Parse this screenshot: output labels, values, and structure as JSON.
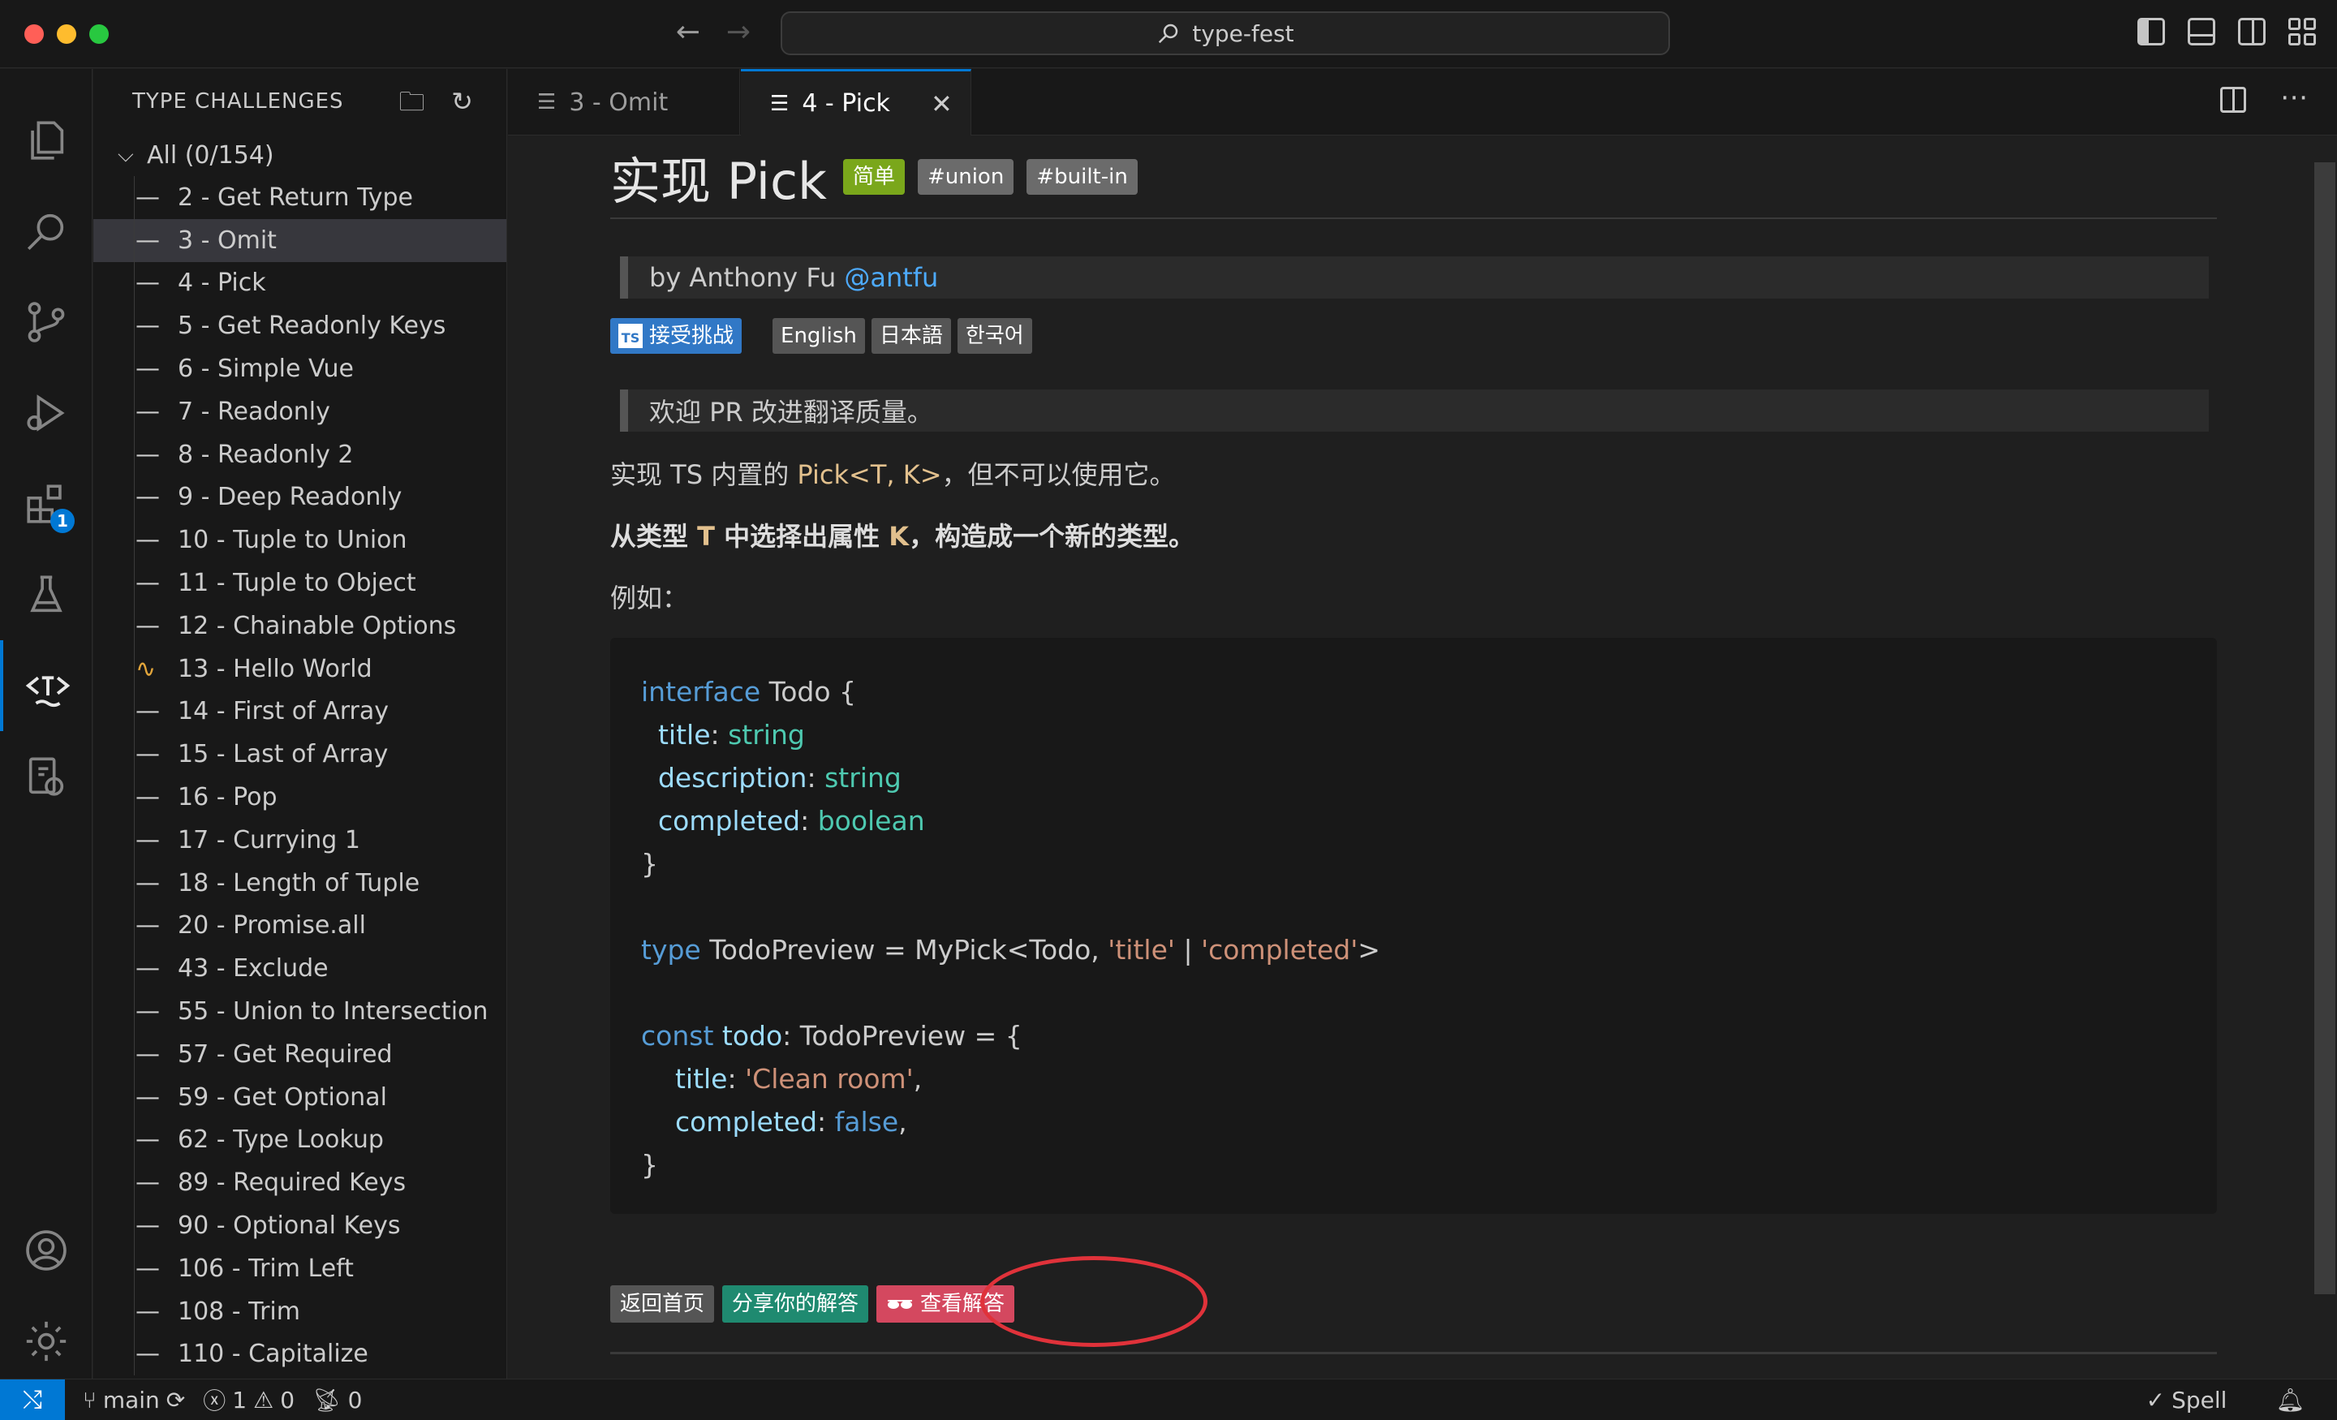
{
  "window": {
    "search_text": "type-fest"
  },
  "sidebar": {
    "header": "TYPE CHALLENGES",
    "root_label": "All (0/154)",
    "items": [
      {
        "label": "2 - Get Return Type",
        "mark": "—"
      },
      {
        "label": "3 - Omit",
        "mark": "—",
        "selected": true
      },
      {
        "label": "4 - Pick",
        "mark": "—"
      },
      {
        "label": "5 - Get Readonly Keys",
        "mark": "—"
      },
      {
        "label": "6 - Simple Vue",
        "mark": "—"
      },
      {
        "label": "7 - Readonly",
        "mark": "—"
      },
      {
        "label": "8 - Readonly 2",
        "mark": "—"
      },
      {
        "label": "9 - Deep Readonly",
        "mark": "—"
      },
      {
        "label": "10 - Tuple to Union",
        "mark": "—"
      },
      {
        "label": "11 - Tuple to Object",
        "mark": "—"
      },
      {
        "label": "12 - Chainable Options",
        "mark": "—"
      },
      {
        "label": "13 - Hello World",
        "mark": "pulse"
      },
      {
        "label": "14 - First of Array",
        "mark": "—"
      },
      {
        "label": "15 - Last of Array",
        "mark": "—"
      },
      {
        "label": "16 - Pop",
        "mark": "—"
      },
      {
        "label": "17 - Currying 1",
        "mark": "—"
      },
      {
        "label": "18 - Length of Tuple",
        "mark": "—"
      },
      {
        "label": "20 - Promise.all",
        "mark": "—"
      },
      {
        "label": "43 - Exclude",
        "mark": "—"
      },
      {
        "label": "55 - Union to Intersection",
        "mark": "—"
      },
      {
        "label": "57 - Get Required",
        "mark": "—"
      },
      {
        "label": "59 - Get Optional",
        "mark": "—"
      },
      {
        "label": "62 - Type Lookup",
        "mark": "—"
      },
      {
        "label": "89 - Required Keys",
        "mark": "—"
      },
      {
        "label": "90 - Optional Keys",
        "mark": "—"
      },
      {
        "label": "106 - Trim Left",
        "mark": "—"
      },
      {
        "label": "108 - Trim",
        "mark": "—"
      },
      {
        "label": "110 - Capitalize",
        "mark": "—"
      }
    ]
  },
  "activity": {
    "extensions_badge": "1"
  },
  "tabs": [
    {
      "label": "3 - Omit",
      "active": false
    },
    {
      "label": "4 - Pick",
      "active": true
    }
  ],
  "doc": {
    "title": "实现 Pick",
    "difficulty": "简单",
    "tags": [
      "#union",
      "#built-in"
    ],
    "author_prefix": "by Anthony Fu",
    "author_handle": "@antfu",
    "take_challenge": "接受挑战",
    "ts_logo": "TS",
    "languages": [
      "English",
      "日本語",
      "한국어"
    ],
    "note": "欢迎 PR 改进翻译质量。",
    "p1_a": "实现 TS 内置的 ",
    "p1_code": "Pick<T, K>",
    "p1_b": "，但不可以使用它。",
    "p2_a": "从类型 ",
    "p2_t": "T",
    "p2_b": " 中选择出属性 ",
    "p2_k": "K",
    "p2_c": "，构造成一个新的类型。",
    "p3": "例如：",
    "code": {
      "l1_kw": "interface",
      "l1_rest": " Todo {",
      "l2_prop": "  title",
      "l2_colon": ": ",
      "l2_type": "string",
      "l3_prop": "  description",
      "l3_colon": ": ",
      "l3_type": "string",
      "l4_prop": "  completed",
      "l4_colon": ": ",
      "l4_type": "boolean",
      "l5": "}",
      "l7_kw": "type",
      "l7_a": " TodoPreview = MyPick<Todo, ",
      "l7_s1": "'title'",
      "l7_b": " | ",
      "l7_s2": "'completed'",
      "l7_c": ">",
      "l9_kw": "const",
      "l9_var": " todo",
      "l9_rest": ": TodoPreview = {",
      "l10_prop": "    title",
      "l10_colon": ": ",
      "l10_str": "'Clean room'",
      "l10_end": ",",
      "l11_prop": "    completed",
      "l11_colon": ": ",
      "l11_val": "false",
      "l11_end": ",",
      "l12": "}"
    },
    "btn_home": "返回首页",
    "btn_share": "分享你的解答",
    "btn_view": "查看解答"
  },
  "status": {
    "branch": "main",
    "errors": "1",
    "warnings": "0",
    "ports": "0",
    "spell": "Spell"
  },
  "colors": {
    "accent": "#0078d4",
    "easy": "#7aa71b",
    "share": "#1f8a70",
    "view": "#d4485f",
    "highlight_ring": "#e0323a"
  }
}
